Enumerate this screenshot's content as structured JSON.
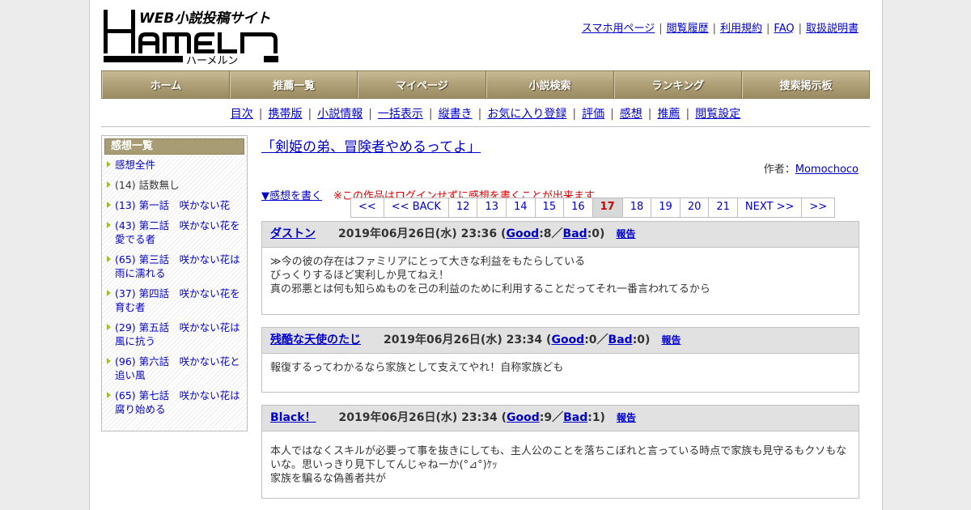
{
  "logo": {
    "tagline": "WEB小説投稿サイト",
    "name": "HAMELN",
    "kana": "ハーメルン"
  },
  "toplinks": [
    "スマホ用ページ",
    "閲覧履歴",
    "利用規約",
    "FAQ",
    "取扱説明書"
  ],
  "mainnav": [
    "ホーム",
    "推薦一覧",
    "マイページ",
    "小説検索",
    "ランキング",
    "捜索掲示板"
  ],
  "subnav": [
    "目次",
    "携帯版",
    "小説情報",
    "一括表示",
    "縦書き",
    "お気に入り登録",
    "評価",
    "感想",
    "推薦",
    "閲覧設定"
  ],
  "sidebar": {
    "title": "感想一覧",
    "items": [
      {
        "text": "感想全件",
        "link": true
      },
      {
        "text": "(14) 話数無し",
        "link": false
      },
      {
        "text": "(13) 第一話　咲かない花",
        "link": true
      },
      {
        "text": "(43) 第二話　咲かない花を愛でる者",
        "link": true
      },
      {
        "text": "(65) 第三話　咲かない花は雨に濡れる",
        "link": true
      },
      {
        "text": "(37) 第四話　咲かない花を育む者",
        "link": true
      },
      {
        "text": "(29) 第五話　咲かない花は風に抗う",
        "link": true
      },
      {
        "text": "(96) 第六話　咲かない花と追い風",
        "link": true
      },
      {
        "text": "(65) 第七話　咲かない花は腐り始める",
        "link": true
      }
    ]
  },
  "work": {
    "title": "「剣姫の弟、冒険者やめるってよ」",
    "author_label": "作者：",
    "author": "Momochoco",
    "write_link": "▼感想を書く",
    "notice": "※この作品はログインせずに感想を書くことが出来ます"
  },
  "pager": {
    "items": [
      "<<",
      "<< BACK",
      "12",
      "13",
      "14",
      "15",
      "16",
      "17",
      "18",
      "19",
      "20",
      "21",
      "NEXT >>",
      ">>"
    ],
    "current": "17"
  },
  "reviews": [
    {
      "name": "ダストン",
      "date": "2019年06月26日(水) 23:36",
      "good_label": "Good",
      "good": ":8／",
      "bad_label": "Bad",
      "bad": ":0)",
      "report": "報告",
      "lines": [
        "≫今の彼の存在はファミリアにとって大きな利益をもたらしている",
        "びっくりするほど実利しか見てねえ！",
        "真の邪悪とは何も知らぬものを己の利益のために利用することだってそれ一番言われてるから"
      ]
    },
    {
      "name": "残酷な天使のたじ",
      "date": "2019年06月26日(水) 23:34",
      "good_label": "Good",
      "good": ":0／",
      "bad_label": "Bad",
      "bad": ":0)",
      "report": "報告",
      "lines": [
        "報復するってわかるなら家族として支えてやれ！自称家族ども"
      ]
    },
    {
      "name": "Black！",
      "date": "2019年06月26日(水) 23:34",
      "good_label": "Good",
      "good": ":9／",
      "bad_label": "Bad",
      "bad": ":1)",
      "report": "報告",
      "lines": [
        "本人ではなくスキルが必要って事を抜きにしても、主人公のことを落ちこぼれと言っている時点で家族も見守るもクソもな",
        "いな。思いっきり見下してんじゃねーか(°⊿°)ｹｯ",
        "家族を騙るな偽善者共が"
      ]
    }
  ]
}
